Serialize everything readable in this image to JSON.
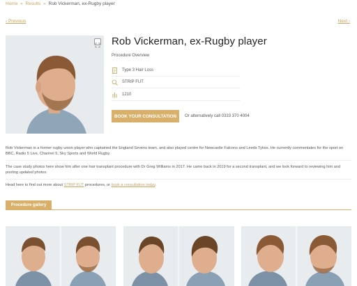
{
  "breadcrumb": {
    "home": "Home",
    "results": "Results",
    "current": "Rob Vickerman, ex-Rugby player",
    "sep": "»"
  },
  "nav": {
    "prev": "‹ Previous",
    "next": "Next ›"
  },
  "case": {
    "title": "Rob Vickerman, ex-Rugby player",
    "subtitle": "Procedure Overview",
    "specs": [
      {
        "icon": "document-icon",
        "value": "Type 3 Hair Loss"
      },
      {
        "icon": "search-icon",
        "value": "STRIP FUT"
      },
      {
        "icon": "follicle-icon",
        "value": "1210"
      }
    ],
    "cta_label": "BOOK YOUR CONSULTATION",
    "call_text": "Or alternatively call 0333 370 4004"
  },
  "description": {
    "p1": "Rob Vickerman is a former rugby union player who captained the England Sevens team, and also played centre for Newcastle Falcons and Leeds Tykes. He currently commentates for the sport on BBC, Radio 5 Live, Channel 5, Sky Sports and World Rugby.",
    "p2": "The case study photos here show him after one hair transplant procedure with Dr Greg Williams in 2017. He came back in 2019 for a second transplant, and we look forward to reviewing him and posting updated photos.",
    "p3_prefix": "Head here to find out more about ",
    "p3_link1": "STRIP FUT",
    "p3_middle": " procedures, or ",
    "p3_link2": "book a consultation today",
    "p3_suffix": "."
  },
  "gallery": {
    "tab_label": "Procedure gallery"
  },
  "colors": {
    "accent": "#d8b06a",
    "link": "#c9a25d"
  }
}
